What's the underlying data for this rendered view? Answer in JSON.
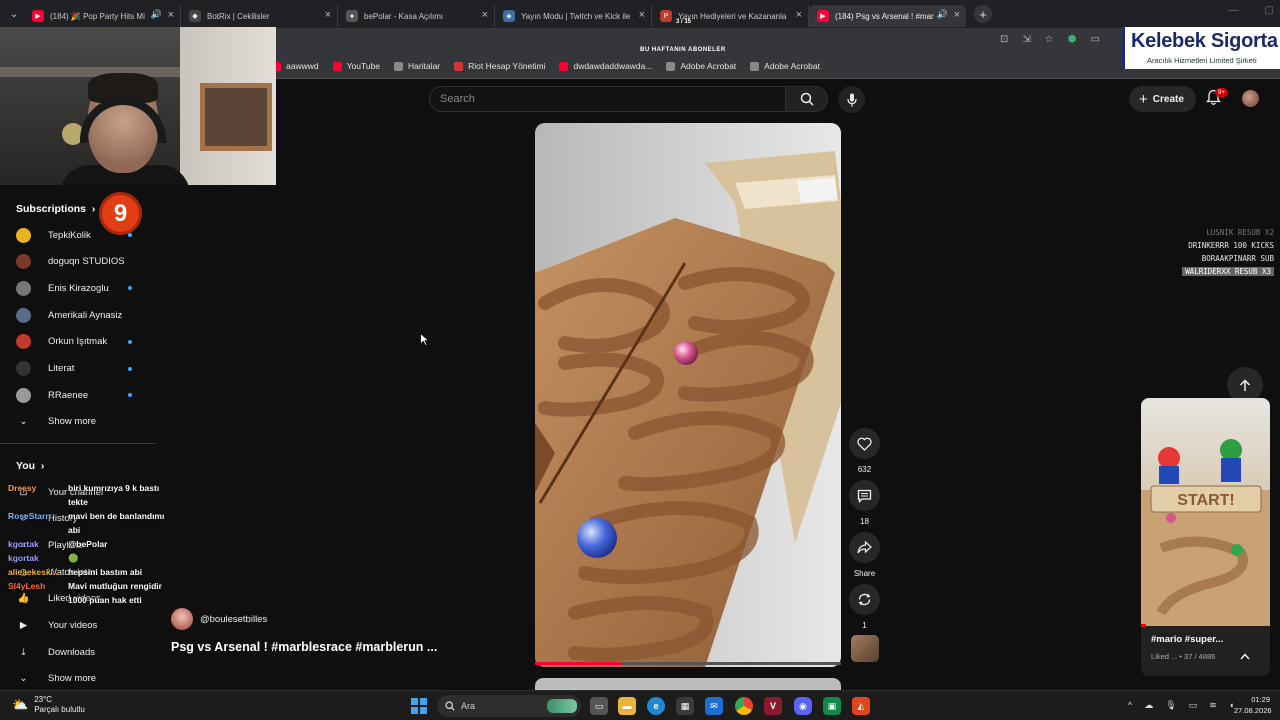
{
  "browser": {
    "tabs": [
      {
        "label": "(184) 🎉 Pop Party Hits Mi",
        "fav_color": "#ff0033",
        "fav_glyph": "▶",
        "sound": true,
        "active": false
      },
      {
        "label": "BotRix | Cekilisler",
        "fav_color": "#444444",
        "fav_glyph": "◆",
        "sound": false,
        "active": false
      },
      {
        "label": "bePolar - Kasa Açılımı",
        "fav_color": "#555555",
        "fav_glyph": "●",
        "sound": false,
        "active": false
      },
      {
        "label": "Yayın Modu | Twitch ve Kick ile",
        "fav_color": "#3b6ea8",
        "fav_glyph": "◈",
        "sound": false,
        "active": false
      },
      {
        "label": "Yayın Hediyeleri ve Kazananla",
        "fav_color": "#c0392b",
        "fav_glyph": "P",
        "sound": false,
        "active": false
      },
      {
        "label": "(184) Psg vs Arsenal ! #mar",
        "fav_color": "#ff0033",
        "fav_glyph": "▶",
        "sound": true,
        "active": true
      }
    ],
    "tab_counter": "3 / 15",
    "bookmarks": [
      {
        "label": "aawwwd",
        "color": "#ff0033"
      },
      {
        "label": "YouTube",
        "color": "#ff0033"
      },
      {
        "label": "Haritalar",
        "color": "#888888"
      },
      {
        "label": "Riot Hesap Yönetimi",
        "color": "#d13639"
      },
      {
        "label": "dwdawdaddwawda...",
        "color": "#ff0033"
      },
      {
        "label": "Adobe Acrobat",
        "color": "#888888"
      },
      {
        "label": "Adobe Acrobat",
        "color": "#888888"
      }
    ]
  },
  "stream": {
    "banner": "BU HAFTANIN ABONELER",
    "ad_brand": "Kelebek Sigorta",
    "ad_sub": "Aracılık Hizmetleri Limited Şirketi",
    "badge_number": "9",
    "events": [
      {
        "text": "LUSNIK RESUB X2",
        "style": "dim"
      },
      {
        "text": "DRINKERRR 100 KICKS",
        "style": "normal"
      },
      {
        "text": "BORAAKPINARR SUB",
        "style": "normal"
      },
      {
        "text": "WALRIDERXX RESUB X3",
        "style": "hl"
      }
    ],
    "chat": [
      {
        "user": "Dreesy",
        "user_color": "#ff9a4d",
        "message": "biri kumrızıya 9 k bastı tekte"
      },
      {
        "user": "RoseStarrr",
        "user_color": "#7fb7ff",
        "message": "mavi ben de banlandımı abi"
      },
      {
        "user": "kgortak",
        "user_color": "#9aa5ff",
        "message": "@bePolar"
      },
      {
        "user": "kgortak",
        "user_color": "#9aa5ff",
        "message": "🟢"
      },
      {
        "user": "alieaekeskl...",
        "user_color": "#ffb03a",
        "message": "hepsini bastım abi"
      },
      {
        "user": "SI4yLesh",
        "user_color": "#ff6f3a",
        "message": "Mavi mutluğun rengidir 1000 puan hak etti"
      }
    ]
  },
  "youtube": {
    "search_placeholder": "Search",
    "create_label": "Create",
    "notifications": "9+",
    "sidebar": {
      "subscriptions_title": "Subscriptions",
      "subscriptions": [
        {
          "name": "TepkiKolik",
          "color": "#e8b422",
          "new": true
        },
        {
          "name": "doguqn STUDIOS",
          "color": "#7a3a2a",
          "new": false
        },
        {
          "name": "Enis Kirazoglu",
          "color": "#777777",
          "new": true
        },
        {
          "name": "Amerikali Aynasiz",
          "color": "#5b6b8a",
          "new": false
        },
        {
          "name": "Orkun Işıtmak",
          "color": "#c0392b",
          "new": true
        },
        {
          "name": "Literat",
          "color": "#333333",
          "new": true
        },
        {
          "name": "RRaenee",
          "color": "#9a9a9a",
          "new": true
        }
      ],
      "show_more": "Show more",
      "you_title": "You",
      "you_items": [
        {
          "label": "Your channel",
          "icon": "user-icon"
        },
        {
          "label": "History",
          "icon": "history-icon"
        },
        {
          "label": "Playlists",
          "icon": "playlist-icon"
        },
        {
          "label": "Watch later",
          "icon": "clock-icon"
        },
        {
          "label": "Liked videos",
          "icon": "thumbs-up-icon"
        },
        {
          "label": "Your videos",
          "icon": "video-icon"
        },
        {
          "label": "Downloads",
          "icon": "download-icon"
        }
      ],
      "show_more_2": "Show more"
    },
    "short": {
      "channel": "@boulesetbilles",
      "title": "Psg vs Arsenal ! #marblesrace #marblerun ...",
      "likes": "632",
      "comments": "18",
      "share": "Share",
      "remix": "1",
      "progress_fraction": 0.28
    },
    "mini": {
      "title": "#mario #super...",
      "sub": "Liked ... • 37 / 4886"
    }
  },
  "taskbar": {
    "temp": "23°C",
    "weather": "Parçalı bulutlu",
    "search": "Ara",
    "time": "01:29",
    "date": "27.08.2026"
  }
}
